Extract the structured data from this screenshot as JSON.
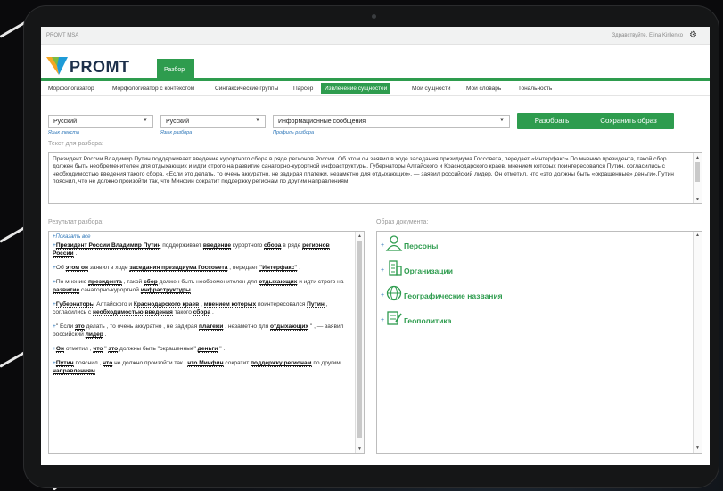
{
  "window": {
    "app_name": "PROMT MSA",
    "greeting": "Здравствуйте, Elina Kirilenko"
  },
  "logo": {
    "text": "PROMT"
  },
  "tabs": {
    "parse": "Разбор"
  },
  "nav": [
    "Морфологизатор",
    "Морфологизатор с контекстом",
    "Синтаксические группы",
    "Парсер",
    "Извлечение сущностей",
    "Мои сущности",
    "Мой словарь",
    "Тональность"
  ],
  "nav_active_index": 4,
  "controls": {
    "text_lang": {
      "value": "Русский",
      "hint": "Язык текста"
    },
    "parse_lang": {
      "value": "Русский",
      "hint": "Язык разбора"
    },
    "profile": {
      "value": "Информационные сообщения",
      "hint": "Профиль разбора"
    },
    "parse_button": "Разобрать",
    "save_button": "Сохранить образ"
  },
  "input": {
    "label": "Текст для разбора:",
    "text": "Президент России Владимир Путин поддерживает введение курортного сбора в ряде регионов России. Об этом он заявил в ходе заседания президиума Госсовета, передает «Интерфакс».По мнению президента, такой сбор должен быть необременителен для отдыхающих и идти строго на развитие санаторно-курортной инфраструктуры. Губернаторы Алтайского и Краснодарского краев, мнением которых поинтересовался Путин, согласились с необходимостью введения такого сбора. «Если это делать, то очень аккуратно, не задирая платежи, незаметно для отдыхающих», — заявил российский лидер. Он отметил, что «это должны быть «окрашенные» деньги».Путин пояснил, что не должно произойти так, что Минфин сократит поддержку регионам по другим направлениям."
  },
  "result": {
    "label": "Результат разбора:",
    "show_all": "+Показать все",
    "p1": {
      "a": "Президент России Владимир Путин",
      "b": " поддерживает ",
      "c": "введение",
      "d": " курортного ",
      "e": "сбора",
      "f": " в ряде ",
      "g": "регионов России",
      "h": " ."
    },
    "p2": {
      "a": "Об ",
      "b": "этом он",
      "c": " заявил в ходе ",
      "d": "заседания президиума Госсовета",
      "e": " , передает ",
      "f": "\"Интерфакс\"",
      "g": " ."
    },
    "p3": {
      "a": "По мнению ",
      "b": "президента",
      "c": " , такой ",
      "d": "сбор",
      "e": " должен быть необременителен для ",
      "f": "отдыхающих",
      "g": " и идти строго на ",
      "h": "развитие",
      "i": " санаторно-курортной ",
      "j": "инфраструктуры",
      "k": " ."
    },
    "p4": {
      "a": "Губернаторы",
      "b": " Алтайского и ",
      "c": "Краснодарского краев",
      "d": " , ",
      "e": "мнением которых",
      "f": " поинтересовался ",
      "g": "Путин",
      "h": " , согласились с ",
      "i": "необходимостью введения",
      "j": " такого ",
      "k": "сбора",
      "l": " ."
    },
    "p5": {
      "a": "\" Если ",
      "b": "это",
      "c": " делать , то очень аккуратно , не задирая ",
      "d": "платежи",
      "e": " , незаметно для ",
      "f": "отдыхающих",
      "g": " \" , — заявил российский ",
      "h": "лидер",
      "i": " ."
    },
    "p6": {
      "a": "Он",
      "b": " отметил , ",
      "c": "что",
      "d": " \" ",
      "e": "это",
      "f": " должны быть \"окрашенные\" ",
      "g": "деньги",
      "h": " \" ."
    },
    "p7": {
      "a": "Путин",
      "b": " пояснил , ",
      "c": "что",
      "d": " не должно произойти так , ",
      "e": "что Минфин",
      "f": " сократит ",
      "g": "поддержку регионам",
      "h": " по другим ",
      "i": "направлениям",
      "j": " ."
    }
  },
  "doc": {
    "label": "Образ документа:",
    "plus": "+",
    "items": [
      {
        "label": "Персоны",
        "icon": "person-icon"
      },
      {
        "label": "Организации",
        "icon": "building-icon"
      },
      {
        "label": "Географические названия",
        "icon": "globe-icon"
      },
      {
        "label": "Геополитика",
        "icon": "geopolitics-icon"
      }
    ]
  },
  "colors": {
    "accent": "#2e9c4e",
    "link": "#2d76b8",
    "logo_text": "#1c2f4a"
  }
}
